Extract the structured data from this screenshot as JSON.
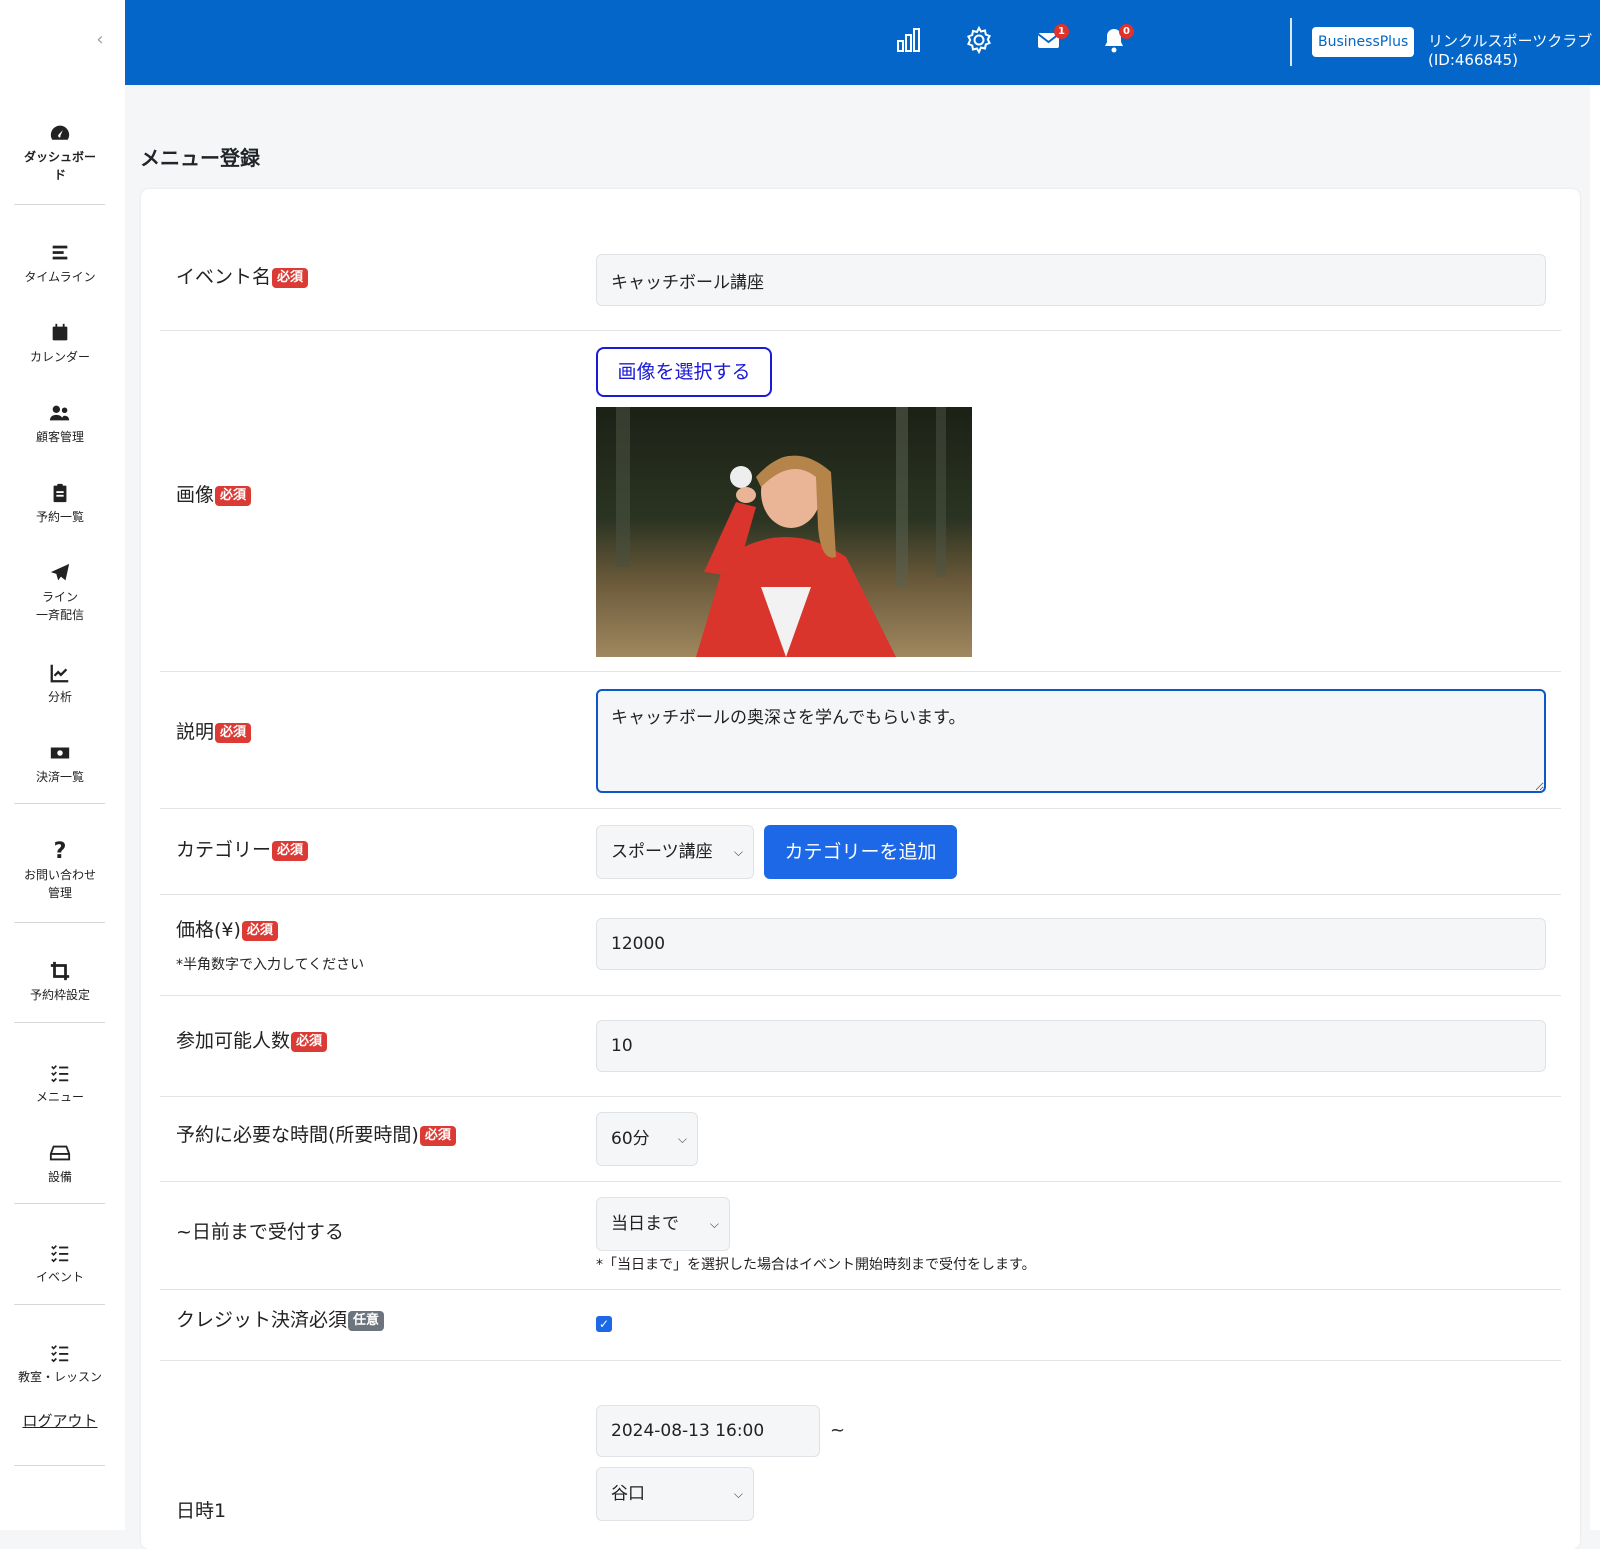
{
  "sidebar": {
    "collapse_icon": "chevron-left-icon",
    "items": [
      {
        "label": "ダッシュボー\nド",
        "icon": "gauge-icon"
      },
      {
        "label": "タイムライン",
        "icon": "bars-icon"
      },
      {
        "label": "カレンダー",
        "icon": "calendar-icon"
      },
      {
        "label": "顧客管理",
        "icon": "users-icon"
      },
      {
        "label": "予約一覧",
        "icon": "clipboard-icon"
      },
      {
        "label": "ライン\n一斉配信",
        "icon": "paper-plane-icon"
      },
      {
        "label": "分析",
        "icon": "chart-line-icon"
      },
      {
        "label": "決済一覧",
        "icon": "money-icon"
      },
      {
        "label": "お問い合わせ\n管理",
        "icon": "question-icon"
      },
      {
        "label": "予約枠設定",
        "icon": "crop-icon"
      },
      {
        "label": "メニュー",
        "icon": "list-check-icon"
      },
      {
        "label": "設備",
        "icon": "hdd-icon"
      },
      {
        "label": "イベント",
        "icon": "list-check-icon"
      },
      {
        "label": "教室・レッスン",
        "icon": "list-check-icon"
      }
    ],
    "logout": "ログアウト"
  },
  "header": {
    "notifications": {
      "mail_count": "1",
      "bell_count": "0"
    },
    "plan": "BusinessPlus",
    "account": "リンクルスポーツクラブ (ID:466845)",
    "brand_color": "#0466c8"
  },
  "page": {
    "title": "メニュー登録"
  },
  "form": {
    "required_badge": "必須",
    "optional_badge": "任意",
    "event_name": {
      "label": "イベント名",
      "value": "キャッチボール講座"
    },
    "image": {
      "label": "画像",
      "button": "画像を選択する"
    },
    "description": {
      "label": "説明",
      "value": "キャッチボールの奥深さを学んでもらいます。"
    },
    "category": {
      "label": "カテゴリー",
      "selected": "スポーツ講座",
      "add_button": "カテゴリーを追加"
    },
    "price": {
      "label": "価格(¥)",
      "hint": "*半角数字で入力してください",
      "value": "12000"
    },
    "capacity": {
      "label": "参加可能人数",
      "value": "10"
    },
    "duration": {
      "label": "予約に必要な時間(所要時間)",
      "selected": "60分"
    },
    "deadline": {
      "label": "~日前まで受付する",
      "selected": "当日まで",
      "hint": "*「当日まで」を選択した場合はイベント開始時刻まで受付をします。"
    },
    "credit": {
      "label": "クレジット決済必須",
      "checked": true
    },
    "datetime1": {
      "label": "日時1",
      "start": "2024-08-13 16:00",
      "separator": "~",
      "staff": "谷口"
    }
  }
}
